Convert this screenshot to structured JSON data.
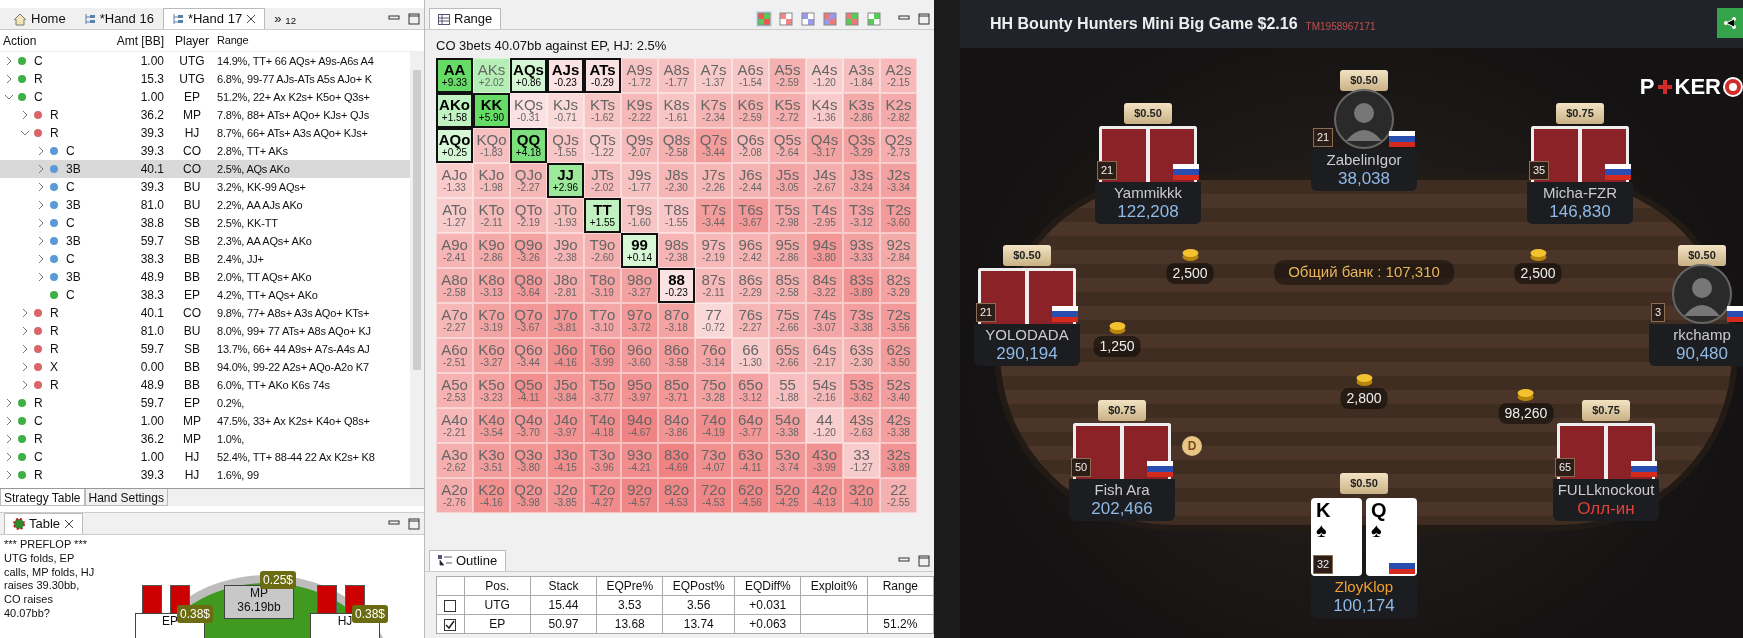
{
  "left_panel": {
    "tabs": [
      {
        "label": "Home",
        "kind": "home",
        "selected": false
      },
      {
        "label": "*Hand 16",
        "kind": "hand",
        "selected": false
      },
      {
        "label": "*Hand 17",
        "kind": "hand",
        "selected": true
      }
    ],
    "overflow": "»$_{12}$"
  },
  "strategy_table": {
    "columns": [
      "Action",
      "Amt [BB]",
      "Player",
      "Range"
    ],
    "rows": [
      {
        "action": "C",
        "amt": "1.00",
        "player": "UTG",
        "range": "14.9%, TT+ 66 AQs+ A9s-A6s A4",
        "color": "#3cb043",
        "expanded": false,
        "selected": false
      },
      {
        "action": "R",
        "amt": "15.3",
        "player": "UTG",
        "range": "6.8%, 99-77 AJs-ATs A5s AJo+ K",
        "color": "#3cb043",
        "expanded": false,
        "selected": false
      },
      {
        "action": "C",
        "amt": "1.00",
        "player": "EP",
        "range": "51.2%, 22+ Ax K2s+ K5o+ Q3s+",
        "color": "#3cb043",
        "expanded": true,
        "selected": false,
        "children": [
          {
            "action": "R",
            "amt": "36.2",
            "player": "MP",
            "range": "7.8%, 88+ ATs+ AQo+ KJs+ QJs",
            "color": "#d9656b",
            "expanded": false,
            "selected": false
          },
          {
            "action": "R",
            "amt": "39.3",
            "player": "HJ",
            "range": "8.7%, 66+ ATs+ A3s AQo+ KJs+",
            "color": "#d9656b",
            "expanded": true,
            "selected": false,
            "children": [
              {
                "action": "C",
                "amt": "39.3",
                "player": "CO",
                "range": "2.8%, TT+ AKs",
                "color": "#5b9bd5",
                "expanded": false,
                "selected": false
              },
              {
                "action": "3B",
                "amt": "40.1",
                "player": "CO",
                "range": "2.5%, AQs AKo",
                "color": "#5b9bd5",
                "expanded": false,
                "selected": true
              },
              {
                "action": "C",
                "amt": "39.3",
                "player": "BU",
                "range": "3.2%, KK-99 AQs+",
                "color": "#5b9bd5",
                "expanded": false,
                "selected": false
              },
              {
                "action": "3B",
                "amt": "81.0",
                "player": "BU",
                "range": "2.2%, AA AJs AKo",
                "color": "#5b9bd5",
                "expanded": false,
                "selected": false
              },
              {
                "action": "C",
                "amt": "38.8",
                "player": "SB",
                "range": "2.5%, KK-TT",
                "color": "#5b9bd5",
                "expanded": false,
                "selected": false
              },
              {
                "action": "3B",
                "amt": "59.7",
                "player": "SB",
                "range": "2.3%, AA AQs+ AKo",
                "color": "#5b9bd5",
                "expanded": false,
                "selected": false
              },
              {
                "action": "C",
                "amt": "38.3",
                "player": "BB",
                "range": "2.4%, JJ+",
                "color": "#5b9bd5",
                "expanded": false,
                "selected": false
              },
              {
                "action": "3B",
                "amt": "48.9",
                "player": "BB",
                "range": "2.0%, TT AQs+ AKo",
                "color": "#5b9bd5",
                "expanded": false,
                "selected": false
              },
              {
                "action": "C",
                "amt": "38.3",
                "player": "EP",
                "range": "4.2%, TT+ AQs+ AKo",
                "color": "#3cb043",
                "selected": false
              }
            ]
          },
          {
            "action": "R",
            "amt": "40.1",
            "player": "CO",
            "range": "9.8%, 77+ A8s+ A3s AQo+ KTs+",
            "color": "#d9656b",
            "expanded": false,
            "selected": false
          },
          {
            "action": "R",
            "amt": "81.0",
            "player": "BU",
            "range": "8.0%, 99+ 77 ATs+ A8s AQo+ KJ",
            "color": "#d9656b",
            "expanded": false,
            "selected": false
          },
          {
            "action": "R",
            "amt": "59.7",
            "player": "SB",
            "range": "13.7%, 66+ 44 A9s+ A7s-A4s AJ",
            "color": "#d9656b",
            "expanded": false,
            "selected": false
          },
          {
            "action": "X",
            "amt": "0.00",
            "player": "BB",
            "range": "94.0%, 99-22 A2s+ AQo-A2o K7",
            "color": "#d9656b",
            "expanded": false,
            "selected": false
          },
          {
            "action": "R",
            "amt": "48.9",
            "player": "BB",
            "range": "6.0%, TT+ AKo K6s 74s",
            "color": "#d9656b",
            "expanded": false,
            "selected": false
          }
        ]
      },
      {
        "action": "R",
        "amt": "59.7",
        "player": "EP",
        "range": "0.2%,",
        "color": "#3cb043",
        "expanded": false,
        "selected": false
      },
      {
        "action": "C",
        "amt": "1.00",
        "player": "MP",
        "range": "47.5%, 33+ Ax K2s+ K4o+ Q8s+",
        "color": "#3cb043",
        "expanded": false,
        "selected": false
      },
      {
        "action": "R",
        "amt": "36.2",
        "player": "MP",
        "range": "1.0%,",
        "color": "#3cb043",
        "expanded": false,
        "selected": false
      },
      {
        "action": "C",
        "amt": "1.00",
        "player": "HJ",
        "range": "52.4%, TT+ 88-44 22 Ax K2s+ K8",
        "color": "#3cb043",
        "expanded": false,
        "selected": false
      },
      {
        "action": "R",
        "amt": "39.3",
        "player": "HJ",
        "range": "1.6%, 99",
        "color": "#3cb043",
        "expanded": false,
        "selected": false
      }
    ]
  },
  "bottom_tabs": [
    {
      "label": "Strategy Table",
      "selected": true
    },
    {
      "label": "Hand Settings",
      "selected": false
    }
  ],
  "table_view": {
    "tab": "Table",
    "log_title": "*** PREFLOP ***",
    "log": "UTG folds, EP calls, MP folds, HJ raises 39.30bb, CO raises 40.07bb?",
    "seats": [
      {
        "name": "EP",
        "bet": "0.38$",
        "folded": false
      },
      {
        "name": "MP",
        "stack": "36.19bb",
        "bet": "0.25$",
        "folded": true
      },
      {
        "name": "HJ",
        "bet": "0.38$",
        "folded": false
      }
    ]
  },
  "range": {
    "tab": "Range",
    "view_modes": [
      {
        "selected": true
      },
      {
        "selected": false
      },
      {
        "selected": false
      },
      {
        "selected": false
      },
      {
        "selected": false
      },
      {
        "selected": false
      }
    ],
    "title": "CO 3bets 40.07bb against EP, HJ: 2.5%",
    "grid": [
      [
        {
          "hand": "AA",
          "ev": "+9.33",
          "selected": true
        },
        {
          "hand": "AKs",
          "ev": "+2.02",
          "selected": false
        },
        {
          "hand": "AQs",
          "ev": "+0.86",
          "selected": true
        },
        {
          "hand": "AJs",
          "ev": "-0.23",
          "selected": true
        },
        {
          "hand": "ATs",
          "ev": "-0.29",
          "selected": true
        },
        {
          "hand": "A9s",
          "ev": "-1.72",
          "selected": false
        },
        {
          "hand": "A8s",
          "ev": "-1.77",
          "selected": false
        },
        {
          "hand": "A7s",
          "ev": "-1.37",
          "selected": false
        },
        {
          "hand": "A6s",
          "ev": "-1.54",
          "selected": false
        },
        {
          "hand": "A5s",
          "ev": "-2.59",
          "selected": false
        },
        {
          "hand": "A4s",
          "ev": "-1.20",
          "selected": false
        },
        {
          "hand": "A3s",
          "ev": "-1.84",
          "selected": false
        },
        {
          "hand": "A2s",
          "ev": "-2.15",
          "selected": false
        }
      ],
      [
        {
          "hand": "AKo",
          "ev": "+1.58",
          "selected": true
        },
        {
          "hand": "KK",
          "ev": "+5.90",
          "selected": true
        },
        {
          "hand": "KQs",
          "ev": "-0.31",
          "selected": false
        },
        {
          "hand": "KJs",
          "ev": "-0.71",
          "selected": false
        },
        {
          "hand": "KTs",
          "ev": "-1.62",
          "selected": false
        },
        {
          "hand": "K9s",
          "ev": "-2.22",
          "selected": false
        },
        {
          "hand": "K8s",
          "ev": "-1.61",
          "selected": false
        },
        {
          "hand": "K7s",
          "ev": "-2.34",
          "selected": false
        },
        {
          "hand": "K6s",
          "ev": "-2.59",
          "selected": false
        },
        {
          "hand": "K5s",
          "ev": "-2.72",
          "selected": false
        },
        {
          "hand": "K4s",
          "ev": "-1.36",
          "selected": false
        },
        {
          "hand": "K3s",
          "ev": "-2.86",
          "selected": false
        },
        {
          "hand": "K2s",
          "ev": "-2.82",
          "selected": false
        }
      ],
      [
        {
          "hand": "AQo",
          "ev": "+0.25",
          "selected": true
        },
        {
          "hand": "KQo",
          "ev": "-1.83",
          "selected": false
        },
        {
          "hand": "QQ",
          "ev": "+4.18",
          "selected": true
        },
        {
          "hand": "QJs",
          "ev": "-1.55",
          "selected": false
        },
        {
          "hand": "QTs",
          "ev": "-1.22",
          "selected": false
        },
        {
          "hand": "Q9s",
          "ev": "-2.07",
          "selected": false
        },
        {
          "hand": "Q8s",
          "ev": "-2.58",
          "selected": false
        },
        {
          "hand": "Q7s",
          "ev": "-3.44",
          "selected": false
        },
        {
          "hand": "Q6s",
          "ev": "-2.08",
          "selected": false
        },
        {
          "hand": "Q5s",
          "ev": "-2.64",
          "selected": false
        },
        {
          "hand": "Q4s",
          "ev": "-3.17",
          "selected": false
        },
        {
          "hand": "Q3s",
          "ev": "-3.29",
          "selected": false
        },
        {
          "hand": "Q2s",
          "ev": "-2.73",
          "selected": false
        }
      ],
      [
        {
          "hand": "AJo",
          "ev": "-1.33",
          "selected": false
        },
        {
          "hand": "KJo",
          "ev": "-1.98",
          "selected": false
        },
        {
          "hand": "QJo",
          "ev": "-2.27",
          "selected": false
        },
        {
          "hand": "JJ",
          "ev": "+2.96",
          "selected": true
        },
        {
          "hand": "JTs",
          "ev": "-2.02",
          "selected": false
        },
        {
          "hand": "J9s",
          "ev": "-1.77",
          "selected": false
        },
        {
          "hand": "J8s",
          "ev": "-2.30",
          "selected": false
        },
        {
          "hand": "J7s",
          "ev": "-2.26",
          "selected": false
        },
        {
          "hand": "J6s",
          "ev": "-2.44",
          "selected": false
        },
        {
          "hand": "J5s",
          "ev": "-3.05",
          "selected": false
        },
        {
          "hand": "J4s",
          "ev": "-2.67",
          "selected": false
        },
        {
          "hand": "J3s",
          "ev": "-3.24",
          "selected": false
        },
        {
          "hand": "J2s",
          "ev": "-3.34",
          "selected": false
        }
      ],
      [
        {
          "hand": "ATo",
          "ev": "-1.27",
          "selected": false
        },
        {
          "hand": "KTo",
          "ev": "-2.11",
          "selected": false
        },
        {
          "hand": "QTo",
          "ev": "-2.19",
          "selected": false
        },
        {
          "hand": "JTo",
          "ev": "-1.93",
          "selected": false
        },
        {
          "hand": "TT",
          "ev": "+1.55",
          "selected": true
        },
        {
          "hand": "T9s",
          "ev": "-1.60",
          "selected": false
        },
        {
          "hand": "T8s",
          "ev": "-1.55",
          "selected": false
        },
        {
          "hand": "T7s",
          "ev": "-3.44",
          "selected": false
        },
        {
          "hand": "T6s",
          "ev": "-3.67",
          "selected": false
        },
        {
          "hand": "T5s",
          "ev": "-2.98",
          "selected": false
        },
        {
          "hand": "T4s",
          "ev": "-2.95",
          "selected": false
        },
        {
          "hand": "T3s",
          "ev": "-3.12",
          "selected": false
        },
        {
          "hand": "T2s",
          "ev": "-3.60",
          "selected": false
        }
      ],
      [
        {
          "hand": "A9o",
          "ev": "-2.41",
          "selected": false
        },
        {
          "hand": "K9o",
          "ev": "-2.86",
          "selected": false
        },
        {
          "hand": "Q9o",
          "ev": "-3.26",
          "selected": false
        },
        {
          "hand": "J9o",
          "ev": "-2.38",
          "selected": false
        },
        {
          "hand": "T9o",
          "ev": "-2.60",
          "selected": false
        },
        {
          "hand": "99",
          "ev": "+0.14",
          "selected": true
        },
        {
          "hand": "98s",
          "ev": "-2.38",
          "selected": false
        },
        {
          "hand": "97s",
          "ev": "-2.19",
          "selected": false
        },
        {
          "hand": "96s",
          "ev": "-2.42",
          "selected": false
        },
        {
          "hand": "95s",
          "ev": "-2.86",
          "selected": false
        },
        {
          "hand": "94s",
          "ev": "-3.80",
          "selected": false
        },
        {
          "hand": "93s",
          "ev": "-3.33",
          "selected": false
        },
        {
          "hand": "92s",
          "ev": "-2.84",
          "selected": false
        }
      ],
      [
        {
          "hand": "A8o",
          "ev": "-2.58",
          "selected": false
        },
        {
          "hand": "K8o",
          "ev": "-3.13",
          "selected": false
        },
        {
          "hand": "Q8o",
          "ev": "-3.64",
          "selected": false
        },
        {
          "hand": "J8o",
          "ev": "-2.81",
          "selected": false
        },
        {
          "hand": "T8o",
          "ev": "-3.19",
          "selected": false
        },
        {
          "hand": "98o",
          "ev": "-3.27",
          "selected": false
        },
        {
          "hand": "88",
          "ev": "-0.23",
          "selected": true
        },
        {
          "hand": "87s",
          "ev": "-2.11",
          "selected": false
        },
        {
          "hand": "86s",
          "ev": "-2.29",
          "selected": false
        },
        {
          "hand": "85s",
          "ev": "-2.58",
          "selected": false
        },
        {
          "hand": "84s",
          "ev": "-3.22",
          "selected": false
        },
        {
          "hand": "83s",
          "ev": "-3.89",
          "selected": false
        },
        {
          "hand": "82s",
          "ev": "-3.29",
          "selected": false
        }
      ],
      [
        {
          "hand": "A7o",
          "ev": "-2.27",
          "selected": false
        },
        {
          "hand": "K7o",
          "ev": "-3.19",
          "selected": false
        },
        {
          "hand": "Q7o",
          "ev": "-3.67",
          "selected": false
        },
        {
          "hand": "J7o",
          "ev": "-3.81",
          "selected": false
        },
        {
          "hand": "T7o",
          "ev": "-3.10",
          "selected": false
        },
        {
          "hand": "97o",
          "ev": "-3.72",
          "selected": false
        },
        {
          "hand": "87o",
          "ev": "-3.18",
          "selected": false
        },
        {
          "hand": "77",
          "ev": "-0.72",
          "selected": false
        },
        {
          "hand": "76s",
          "ev": "-2.27",
          "selected": false
        },
        {
          "hand": "75s",
          "ev": "-2.66",
          "selected": false
        },
        {
          "hand": "74s",
          "ev": "-3.07",
          "selected": false
        },
        {
          "hand": "73s",
          "ev": "-3.38",
          "selected": false
        },
        {
          "hand": "72s",
          "ev": "-3.56",
          "selected": false
        }
      ],
      [
        {
          "hand": "A6o",
          "ev": "-2.51",
          "selected": false
        },
        {
          "hand": "K6o",
          "ev": "-3.27",
          "selected": false
        },
        {
          "hand": "Q6o",
          "ev": "-3.44",
          "selected": false
        },
        {
          "hand": "J6o",
          "ev": "-4.16",
          "selected": false
        },
        {
          "hand": "T6o",
          "ev": "-3.99",
          "selected": false
        },
        {
          "hand": "96o",
          "ev": "-3.60",
          "selected": false
        },
        {
          "hand": "86o",
          "ev": "-3.58",
          "selected": false
        },
        {
          "hand": "76o",
          "ev": "-3.14",
          "selected": false
        },
        {
          "hand": "66",
          "ev": "-1.30",
          "selected": false
        },
        {
          "hand": "65s",
          "ev": "-2.66",
          "selected": false
        },
        {
          "hand": "64s",
          "ev": "-2.17",
          "selected": false
        },
        {
          "hand": "63s",
          "ev": "-2.30",
          "selected": false
        },
        {
          "hand": "62s",
          "ev": "-3.50",
          "selected": false
        }
      ],
      [
        {
          "hand": "A5o",
          "ev": "-2.53",
          "selected": false
        },
        {
          "hand": "K5o",
          "ev": "-3.23",
          "selected": false
        },
        {
          "hand": "Q5o",
          "ev": "-4.11",
          "selected": false
        },
        {
          "hand": "J5o",
          "ev": "-3.84",
          "selected": false
        },
        {
          "hand": "T5o",
          "ev": "-3.77",
          "selected": false
        },
        {
          "hand": "95o",
          "ev": "-3.97",
          "selected": false
        },
        {
          "hand": "85o",
          "ev": "-3.71",
          "selected": false
        },
        {
          "hand": "75o",
          "ev": "-3.28",
          "selected": false
        },
        {
          "hand": "65o",
          "ev": "-3.12",
          "selected": false
        },
        {
          "hand": "55",
          "ev": "-1.88",
          "selected": false
        },
        {
          "hand": "54s",
          "ev": "-2.16",
          "selected": false
        },
        {
          "hand": "53s",
          "ev": "-3.62",
          "selected": false
        },
        {
          "hand": "52s",
          "ev": "-3.40",
          "selected": false
        }
      ],
      [
        {
          "hand": "A4o",
          "ev": "-2.21",
          "selected": false
        },
        {
          "hand": "K4o",
          "ev": "-3.54",
          "selected": false
        },
        {
          "hand": "Q4o",
          "ev": "-3.70",
          "selected": false
        },
        {
          "hand": "J4o",
          "ev": "-3.97",
          "selected": false
        },
        {
          "hand": "T4o",
          "ev": "-4.18",
          "selected": false
        },
        {
          "hand": "94o",
          "ev": "-4.67",
          "selected": false
        },
        {
          "hand": "84o",
          "ev": "-3.86",
          "selected": false
        },
        {
          "hand": "74o",
          "ev": "-4.19",
          "selected": false
        },
        {
          "hand": "64o",
          "ev": "-3.77",
          "selected": false
        },
        {
          "hand": "54o",
          "ev": "-3.38",
          "selected": false
        },
        {
          "hand": "44",
          "ev": "-1.20",
          "selected": false
        },
        {
          "hand": "43s",
          "ev": "-2.63",
          "selected": false
        },
        {
          "hand": "42s",
          "ev": "-3.38",
          "selected": false
        }
      ],
      [
        {
          "hand": "A3o",
          "ev": "-2.62",
          "selected": false
        },
        {
          "hand": "K3o",
          "ev": "-3.51",
          "selected": false
        },
        {
          "hand": "Q3o",
          "ev": "-3.80",
          "selected": false
        },
        {
          "hand": "J3o",
          "ev": "-4.15",
          "selected": false
        },
        {
          "hand": "T3o",
          "ev": "-3.96",
          "selected": false
        },
        {
          "hand": "93o",
          "ev": "-4.21",
          "selected": false
        },
        {
          "hand": "83o",
          "ev": "-4.69",
          "selected": false
        },
        {
          "hand": "73o",
          "ev": "-4.07",
          "selected": false
        },
        {
          "hand": "63o",
          "ev": "-4.11",
          "selected": false
        },
        {
          "hand": "53o",
          "ev": "-3.74",
          "selected": false
        },
        {
          "hand": "43o",
          "ev": "-3.99",
          "selected": false
        },
        {
          "hand": "33",
          "ev": "-1.27",
          "selected": false
        },
        {
          "hand": "32s",
          "ev": "-3.89",
          "selected": false
        }
      ],
      [
        {
          "hand": "A2o",
          "ev": "-2.76",
          "selected": false
        },
        {
          "hand": "K2o",
          "ev": "-4.16",
          "selected": false
        },
        {
          "hand": "Q2o",
          "ev": "-3.98",
          "selected": false
        },
        {
          "hand": "J2o",
          "ev": "-3.85",
          "selected": false
        },
        {
          "hand": "T2o",
          "ev": "-4.27",
          "selected": false
        },
        {
          "hand": "92o",
          "ev": "-4.57",
          "selected": false
        },
        {
          "hand": "82o",
          "ev": "-4.53",
          "selected": false
        },
        {
          "hand": "72o",
          "ev": "-4.53",
          "selected": false
        },
        {
          "hand": "62o",
          "ev": "-4.56",
          "selected": false
        },
        {
          "hand": "52o",
          "ev": "-4.25",
          "selected": false
        },
        {
          "hand": "42o",
          "ev": "-4.13",
          "selected": false
        },
        {
          "hand": "32o",
          "ev": "-4.10",
          "selected": false
        },
        {
          "hand": "22",
          "ev": "-2.55",
          "selected": false
        }
      ]
    ]
  },
  "outline": {
    "tab": "Outline",
    "columns": [
      "Pos.",
      "Stack",
      "EQPre%",
      "EQPost%",
      "EQDiff%",
      "Exploit%",
      "Range"
    ],
    "rows": [
      {
        "checked": false,
        "pos": "UTG",
        "stack": "15.44",
        "eq_pre": "3.53",
        "eq_post": "3.56",
        "eq_diff": "+0.031"
      },
      {
        "checked": true,
        "pos": "EP",
        "stack": "50.97",
        "eq_pre": "13.68",
        "eq_post": "13.74",
        "eq_diff": "+0.063",
        "range": "51.2%"
      }
    ]
  },
  "poker": {
    "title": "HH Bounty Hunters Mini Big Game $2.16",
    "tournament_id": "TM1958967171",
    "logo": {
      "start": "P",
      "end": "KER"
    },
    "pot": "Общий банк : 107,310",
    "dealer": "D",
    "seats": [
      {
        "kind": "cards",
        "bounty": "$0.50",
        "level": "21",
        "name": "Yammikkk",
        "stack": "122,208"
      },
      {
        "kind": "avatar",
        "bounty": "$0.50",
        "level": "21",
        "name": "ZabelinIgor",
        "stack": "38,038"
      },
      {
        "kind": "cards",
        "bounty": "$0.75",
        "level": "35",
        "name": "Micha-FZR",
        "stack": "146,830"
      },
      {
        "kind": "cards",
        "bounty": "$0.50",
        "level": "21",
        "name": "YOLODADA",
        "stack": "290,194"
      },
      {
        "kind": "avatar",
        "bounty": "$0.50",
        "level": "3",
        "name": "rkchamp",
        "stack": "90,480"
      },
      {
        "kind": "cards",
        "bounty": "$0.75",
        "level": "50",
        "name": "Fish Ara",
        "stack": "202,466"
      },
      {
        "kind": "cards",
        "bounty": "$0.75",
        "level": "65",
        "name": "FULLknockout",
        "status": "Олл-ин"
      },
      {
        "kind": "hero",
        "bounty": "$0.50",
        "level": "32",
        "name": "ZloyKlop",
        "stack": "100,174",
        "cards": [
          {
            "rank": "K",
            "suit": "♠"
          },
          {
            "rank": "Q",
            "suit": "♠"
          }
        ]
      }
    ],
    "bets": [
      "2,500",
      "2,500",
      "1,250",
      "2,800",
      "98,260"
    ]
  }
}
